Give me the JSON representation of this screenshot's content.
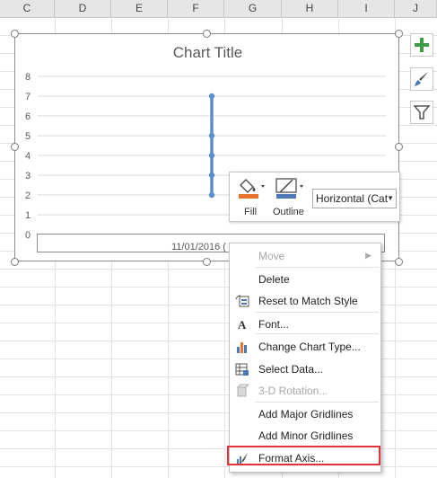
{
  "columns": [
    "C",
    "D",
    "E",
    "F",
    "G",
    "H",
    "I",
    "J"
  ],
  "chart": {
    "title": "Chart Title",
    "y_ticks": [
      "8",
      "7",
      "6",
      "5",
      "4",
      "3",
      "2",
      "1",
      "0"
    ],
    "axis_label": "11/01/2016 (",
    "series_color": "#5b8fca"
  },
  "chart_data": {
    "type": "line",
    "x": [
      "11/01/2016"
    ],
    "series": [
      {
        "values": [
          2,
          3,
          4,
          5,
          7
        ]
      }
    ],
    "ylim": [
      0,
      8
    ],
    "title": "Chart Title",
    "grid": true
  },
  "side_buttons": [
    {
      "name": "chart-elements-button",
      "icon": "plus-icon"
    },
    {
      "name": "chart-styles-button",
      "icon": "brush-icon"
    },
    {
      "name": "chart-filters-button",
      "icon": "filter-icon"
    }
  ],
  "format_bar": {
    "fill_label": "Fill",
    "outline_label": "Outline",
    "element_select": "Horizontal (Cat"
  },
  "context_menu": {
    "items": [
      {
        "label": "Move",
        "disabled": true,
        "icon": ""
      },
      {
        "label": "Delete",
        "disabled": false,
        "icon": ""
      },
      {
        "label": "Reset to Match Style",
        "disabled": false,
        "icon": "reset-style-icon"
      },
      {
        "label": "Font...",
        "disabled": false,
        "icon": "font-icon"
      },
      {
        "label": "Change Chart Type...",
        "disabled": false,
        "icon": "change-chart-type-icon"
      },
      {
        "label": "Select Data...",
        "disabled": false,
        "icon": "select-data-icon"
      },
      {
        "label": "3-D Rotation...",
        "disabled": true,
        "icon": "3d-rotation-icon"
      },
      {
        "label": "Add Major Gridlines",
        "disabled": false,
        "icon": ""
      },
      {
        "label": "Add Minor Gridlines",
        "disabled": false,
        "icon": ""
      },
      {
        "label": "Format Axis...",
        "disabled": false,
        "icon": "format-axis-icon"
      }
    ],
    "highlighted_item": "Format Axis..."
  }
}
